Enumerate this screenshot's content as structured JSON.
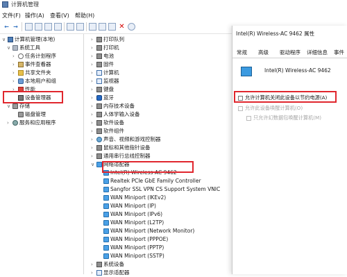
{
  "window": {
    "title": "计算机管理"
  },
  "menu": {
    "file": "文件(F)",
    "action": "操作(A)",
    "view": "查看(V)",
    "help": "帮助(H)"
  },
  "toolbar": {
    "back_icon": "←",
    "forward_icon": "→",
    "delete_icon": "✕"
  },
  "tree": {
    "root": "计算机管理(本地)",
    "system_tools": "系统工具",
    "task_scheduler": "任务计划程序",
    "event_viewer": "事件查看器",
    "shared_folders": "共享文件夹",
    "local_users": "本地用户和组",
    "performance": "性能",
    "device_manager": "设备管理器",
    "storage": "存储",
    "disk_management": "磁盘管理",
    "services": "服务和应用程序"
  },
  "devices": {
    "categories": [
      "打印队列",
      "打印机",
      "电池",
      "固件",
      "计算机",
      "监视器",
      "键盘",
      "蓝牙",
      "内存技术设备",
      "人体学输入设备",
      "软件设备",
      "软件组件",
      "声音、视频和游戏控制器",
      "鼠标和其他指针设备",
      "通用串行总线控制器",
      "网络适配器"
    ],
    "network_adapters": [
      "Intel(R) Wireless-AC 9462",
      "Realtek PCIe GbE Family Controller",
      "Sangfor SSL VPN CS Support System VNIC",
      "WAN Miniport (IKEv2)",
      "WAN Miniport (IP)",
      "WAN Miniport (IPv6)",
      "WAN Miniport (L2TP)",
      "WAN Miniport (Network Monitor)",
      "WAN Miniport (PPPOE)",
      "WAN Miniport (PPTP)",
      "WAN Miniport (SSTP)"
    ],
    "after": [
      "系统设备",
      "显示适配器"
    ]
  },
  "dialog": {
    "title": "Intel(R) Wireless-AC 9462 属性",
    "tabs": [
      "常规",
      "高级",
      "驱动程序",
      "详细信息",
      "事件"
    ],
    "device_name": "Intel(R) Wireless-AC 9462",
    "opt_power_save": "允许计算机关闭此设备以节约电源(A)",
    "opt_wake": "允许此设备唤醒计算机(O)",
    "opt_magic_packet": "只允许幻数据包唤醒计算机(M)"
  },
  "colors": {
    "highlight": "#e0262d",
    "accent": "#2d6fbf"
  }
}
